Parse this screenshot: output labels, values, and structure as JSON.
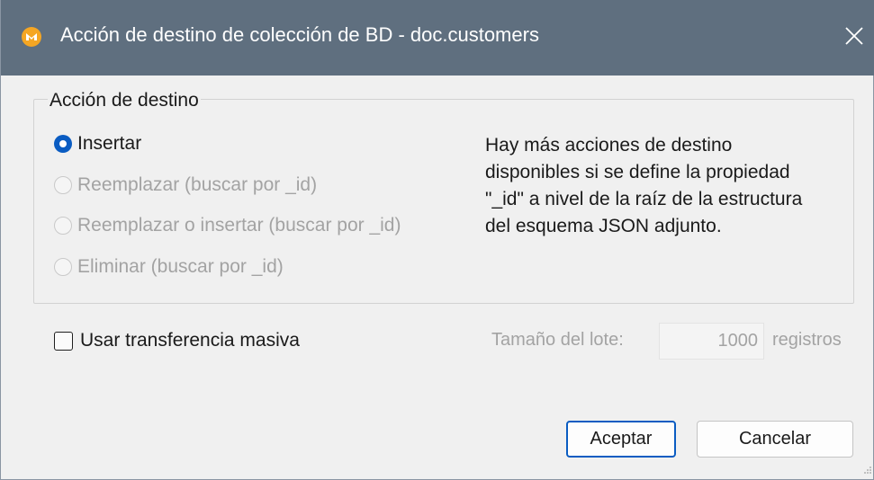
{
  "window": {
    "title": "Acción de destino de colección de BD - doc.customers"
  },
  "target_action": {
    "legend": "Acción de destino",
    "options": [
      {
        "label": "Insertar",
        "checked": true,
        "enabled": true
      },
      {
        "label": "Reemplazar (buscar por _id)",
        "checked": false,
        "enabled": false
      },
      {
        "label": "Reemplazar o insertar (buscar por _id)",
        "checked": false,
        "enabled": false
      },
      {
        "label": "Eliminar (buscar por _id)",
        "checked": false,
        "enabled": false
      }
    ],
    "info_lines": [
      "Hay más acciones de destino",
      "disponibles si se define la propiedad",
      "\"_id\" a nivel de la raíz de la estructura",
      "del esquema JSON adjunto."
    ]
  },
  "bulk": {
    "checkbox_label": "Usar transferencia masiva",
    "checked": false,
    "batch_size_label": "Tamaño del lote:",
    "batch_size_value": "1000",
    "batch_units": "registros"
  },
  "buttons": {
    "ok": "Aceptar",
    "cancel": "Cancelar"
  },
  "colors": {
    "titlebar": "#5f6f7f",
    "accent": "#0a5cc2",
    "app_icon": "#f5a623"
  },
  "icons": {
    "app": "mapforce-app-icon",
    "close": "close-icon"
  }
}
